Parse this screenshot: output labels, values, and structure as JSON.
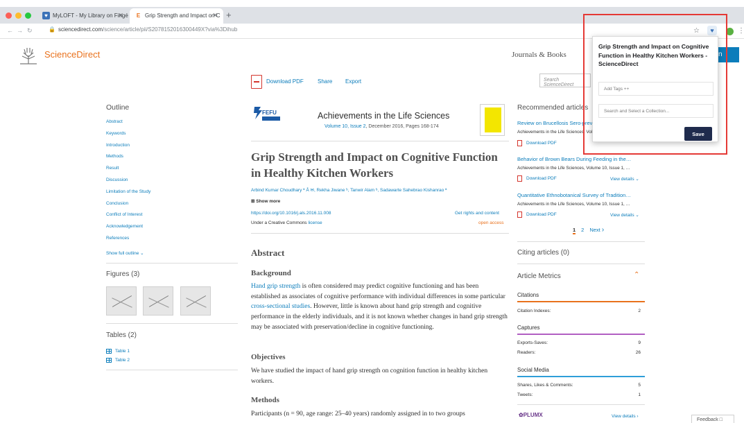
{
  "browser": {
    "tabs": [
      {
        "title": "MyLOFT - My Library on Fingé",
        "favicon": "heart-shield-icon"
      },
      {
        "title": "Grip Strength and Impact on C",
        "favicon": "E"
      }
    ],
    "new_tab": "+",
    "url_host": "sciencedirect.com",
    "url_path": "/science/article/pii/S2078152016300449X?via%3Dihub"
  },
  "site": {
    "logo_text": "ScienceDirect",
    "nav_journals": "Journals & Books",
    "signin": "n",
    "search_placeholder": "Search ScienceDirect"
  },
  "toolbar": {
    "download_pdf": "Download PDF",
    "share": "Share",
    "export": "Export"
  },
  "outline": {
    "title": "Outline",
    "items": [
      "Abstract",
      "Keywords",
      "Introduction",
      "Methods",
      "Result",
      "Discussion",
      "Limitation of the Study",
      "Conclusion",
      "Conflict of Interest",
      "Acknowledgement",
      "References"
    ],
    "show_full": "Show full outline"
  },
  "figures": {
    "title": "Figures (3)",
    "count": 3
  },
  "tables": {
    "title": "Tables (2)",
    "items": [
      "Table 1",
      "Table 2"
    ]
  },
  "article": {
    "publisher_logo": "FEFU",
    "journal": "Achievements in the Life Sciences",
    "volume_link": "Volume 10, Issue 2",
    "volume_rest": ", December 2016, Pages 168-174",
    "title": "Grip Strength and Impact on Cognitive Function in Healthy Kitchen Workers",
    "authors": "Arbind Kumar Choudhary ª Å ✉, Rekha Jiwane ᵇ, Tanwir Alam ᵇ, Sadawarte Sahebrao Kishanrao ª",
    "show_more": "⊞ Show more",
    "doi": "https://doi.org/10.1016/j.als.2016.11.008",
    "license_prefix": "Under a Creative Commons ",
    "license_link": "license",
    "rights": "Get rights and content",
    "open_access": "open access",
    "abstract_heading": "Abstract",
    "background_heading": "Background",
    "background_p1_link1": "Hand grip strength",
    "background_p1_text1": " is often considered may predict cognitive functioning and has been established as associates of cognitive performance with individual differences in some particular ",
    "background_p1_link2": "cross-sectional studies",
    "background_p1_text2": ". However, little is known about hand grip strength and cognitive performance in the elderly individuals, and it is not known whether changes in hand grip strength may be associated with preservation/decline in cognitive functioning.",
    "objectives_heading": "Objectives",
    "objectives_text": "We have studied the impact of hand grip strength on cognition function in healthy kitchen workers.",
    "methods_heading": "Methods",
    "methods_text": "Participants (n = 90, age range: 25–40 years) randomly assigned in to two groups"
  },
  "recommended": {
    "title": "Recommended articles",
    "items": [
      {
        "title": "Review on Brucellosis Sero-prevalence",
        "source": "Achievements in the Life Sciences, Volume 10, Issue 1,",
        "pdf": "Download PDF",
        "details": "View details"
      },
      {
        "title": "Behavior of Brown Bears During Feeding in the…",
        "source": "Achievements in the Life Sciences, Volume 10, Issue 1, …",
        "pdf": "Download PDF",
        "details": "View details"
      },
      {
        "title": "Quantitative Ethnobotanical Survey of Tradition…",
        "source": "Achievements in the Life Sciences, Volume 10, Issue 1, …",
        "pdf": "Download PDF",
        "details": "View details"
      }
    ],
    "pages": [
      "1",
      "2"
    ],
    "next": "Next"
  },
  "citing": {
    "title": "Citing articles (0)"
  },
  "metrics": {
    "title": "Article Metrics",
    "groups": [
      {
        "name": "Citations",
        "color": "#e9711c",
        "rows": [
          {
            "label": "Citation Indexes:",
            "value": "2"
          }
        ]
      },
      {
        "name": "Captures",
        "color": "#b15ec2",
        "rows": [
          {
            "label": "Exports-Saves:",
            "value": "9"
          },
          {
            "label": "Readers:",
            "value": "26"
          }
        ]
      },
      {
        "name": "Social Media",
        "color": "#2f9ed8",
        "rows": [
          {
            "label": "Shares, Likes & Comments:",
            "value": "5"
          },
          {
            "label": "Tweets:",
            "value": "1"
          }
        ]
      }
    ],
    "plumx": "PLUMX",
    "plumx_details": "View details"
  },
  "feedback": "Feedback",
  "popup": {
    "title": "Grip Strength and Impact on Cognitive Function in Healthy Kitchen Workers - ScienceDirect",
    "tags_placeholder": "Add Tags ++",
    "collection_placeholder": "Search and Select a Collection...",
    "save": "Save"
  },
  "colors": {
    "brand_orange": "#e9711c",
    "link_blue": "#0c7dbb",
    "highlight_red": "#e53935",
    "save_button": "#1f2b4d"
  }
}
